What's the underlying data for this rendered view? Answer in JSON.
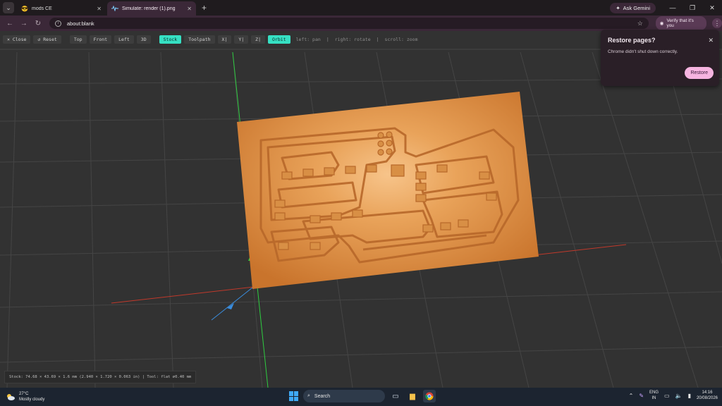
{
  "browser": {
    "tabs": [
      {
        "label": "mods CE",
        "active": false
      },
      {
        "label": "Simulate: render (1).png",
        "active": true
      }
    ],
    "ask_gemini": "Ask Gemini",
    "url": "about:blank",
    "verify_chip": "Verify that it's you"
  },
  "sim": {
    "buttons": {
      "close": "✕ Close",
      "reset": "↺ Reset",
      "top": "Top",
      "front": "Front",
      "left": "Left",
      "view3d": "3D",
      "stock": "Stock",
      "toolpath": "Toolpath",
      "x": "X|",
      "y": "Y|",
      "z": "Z|",
      "orbit": "Orbit"
    },
    "hints": {
      "left": "left: pan",
      "right": "right: rotate",
      "scroll": "scroll: zoom"
    },
    "status": "Stock: 74.68 × 43.69 × 1.6 mm (2.940 × 1.720 × 0.063 in) | Tool: flat ⌀0.40 mm"
  },
  "restore_popup": {
    "title": "Restore pages?",
    "body": "Chrome didn't shut down correctly.",
    "button": "Restore"
  },
  "taskbar": {
    "temperature": "27°C",
    "weather": "Mostly cloudy",
    "search": "Search",
    "lang_top": "ENG",
    "lang_bottom": "IN",
    "time": "14:16",
    "date": "20/08/2026"
  },
  "colors": {
    "accent_on": "#36e0c3",
    "copper": "#e08a3a",
    "axis_x": "#c0392b",
    "axis_y": "#2ecc40",
    "axis_z": "#3a8dde"
  }
}
